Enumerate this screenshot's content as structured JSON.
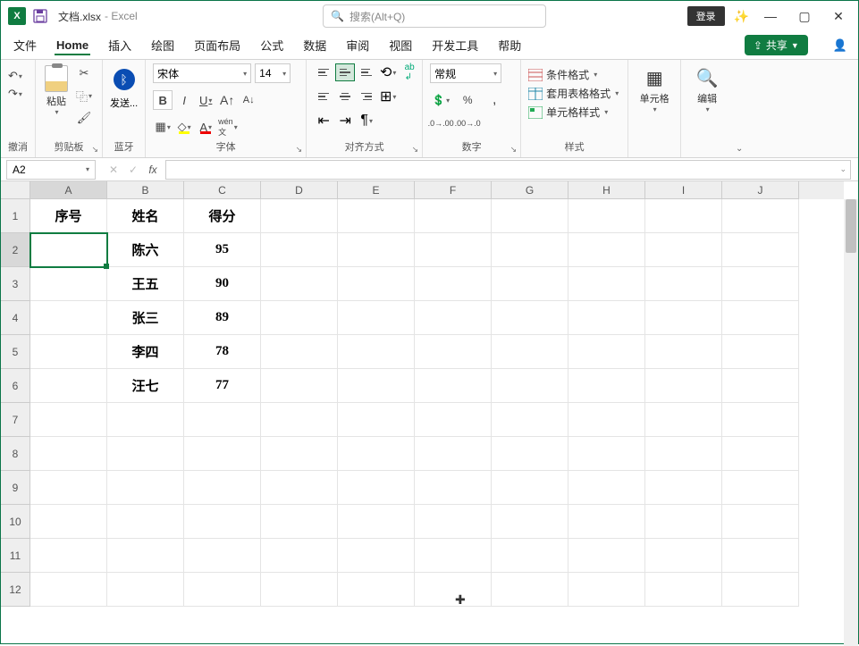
{
  "titlebar": {
    "doc_name": "文档.xlsx",
    "app_name": "Excel",
    "search_placeholder": "搜索(Alt+Q)",
    "login": "登录"
  },
  "menu": {
    "file": "文件",
    "home": "Home",
    "insert": "插入",
    "draw": "绘图",
    "layout": "页面布局",
    "formulas": "公式",
    "data": "数据",
    "review": "审阅",
    "view": "视图",
    "dev": "开发工具",
    "help": "帮助",
    "share": "共享"
  },
  "ribbon": {
    "undo_label": "撤消",
    "clipboard_label": "剪贴板",
    "paste": "粘贴",
    "bt_label": "蓝牙",
    "bt_send": "发送...",
    "font_label": "字体",
    "font_name": "宋体",
    "font_size": "14",
    "align_label": "对齐方式",
    "number_label": "数字",
    "number_format": "常规",
    "styles_label": "样式",
    "cond_fmt": "条件格式",
    "table_fmt": "套用表格格式",
    "cell_style": "单元格样式",
    "cells_label": "单元格",
    "edit_label": "编辑"
  },
  "formula_bar": {
    "name_box": "A2"
  },
  "columns": [
    "A",
    "B",
    "C",
    "D",
    "E",
    "F",
    "G",
    "H",
    "I",
    "J"
  ],
  "rows": [
    "1",
    "2",
    "3",
    "4",
    "5",
    "6",
    "7",
    "8",
    "9",
    "10",
    "11",
    "12"
  ],
  "selected_cell": "A2",
  "chart_data": {
    "type": "table",
    "headers": [
      "序号",
      "姓名",
      "得分"
    ],
    "data": [
      {
        "name": "陈六",
        "score": 95
      },
      {
        "name": "王五",
        "score": 90
      },
      {
        "name": "张三",
        "score": 89
      },
      {
        "name": "李四",
        "score": 78
      },
      {
        "name": "汪七",
        "score": 77
      }
    ]
  }
}
